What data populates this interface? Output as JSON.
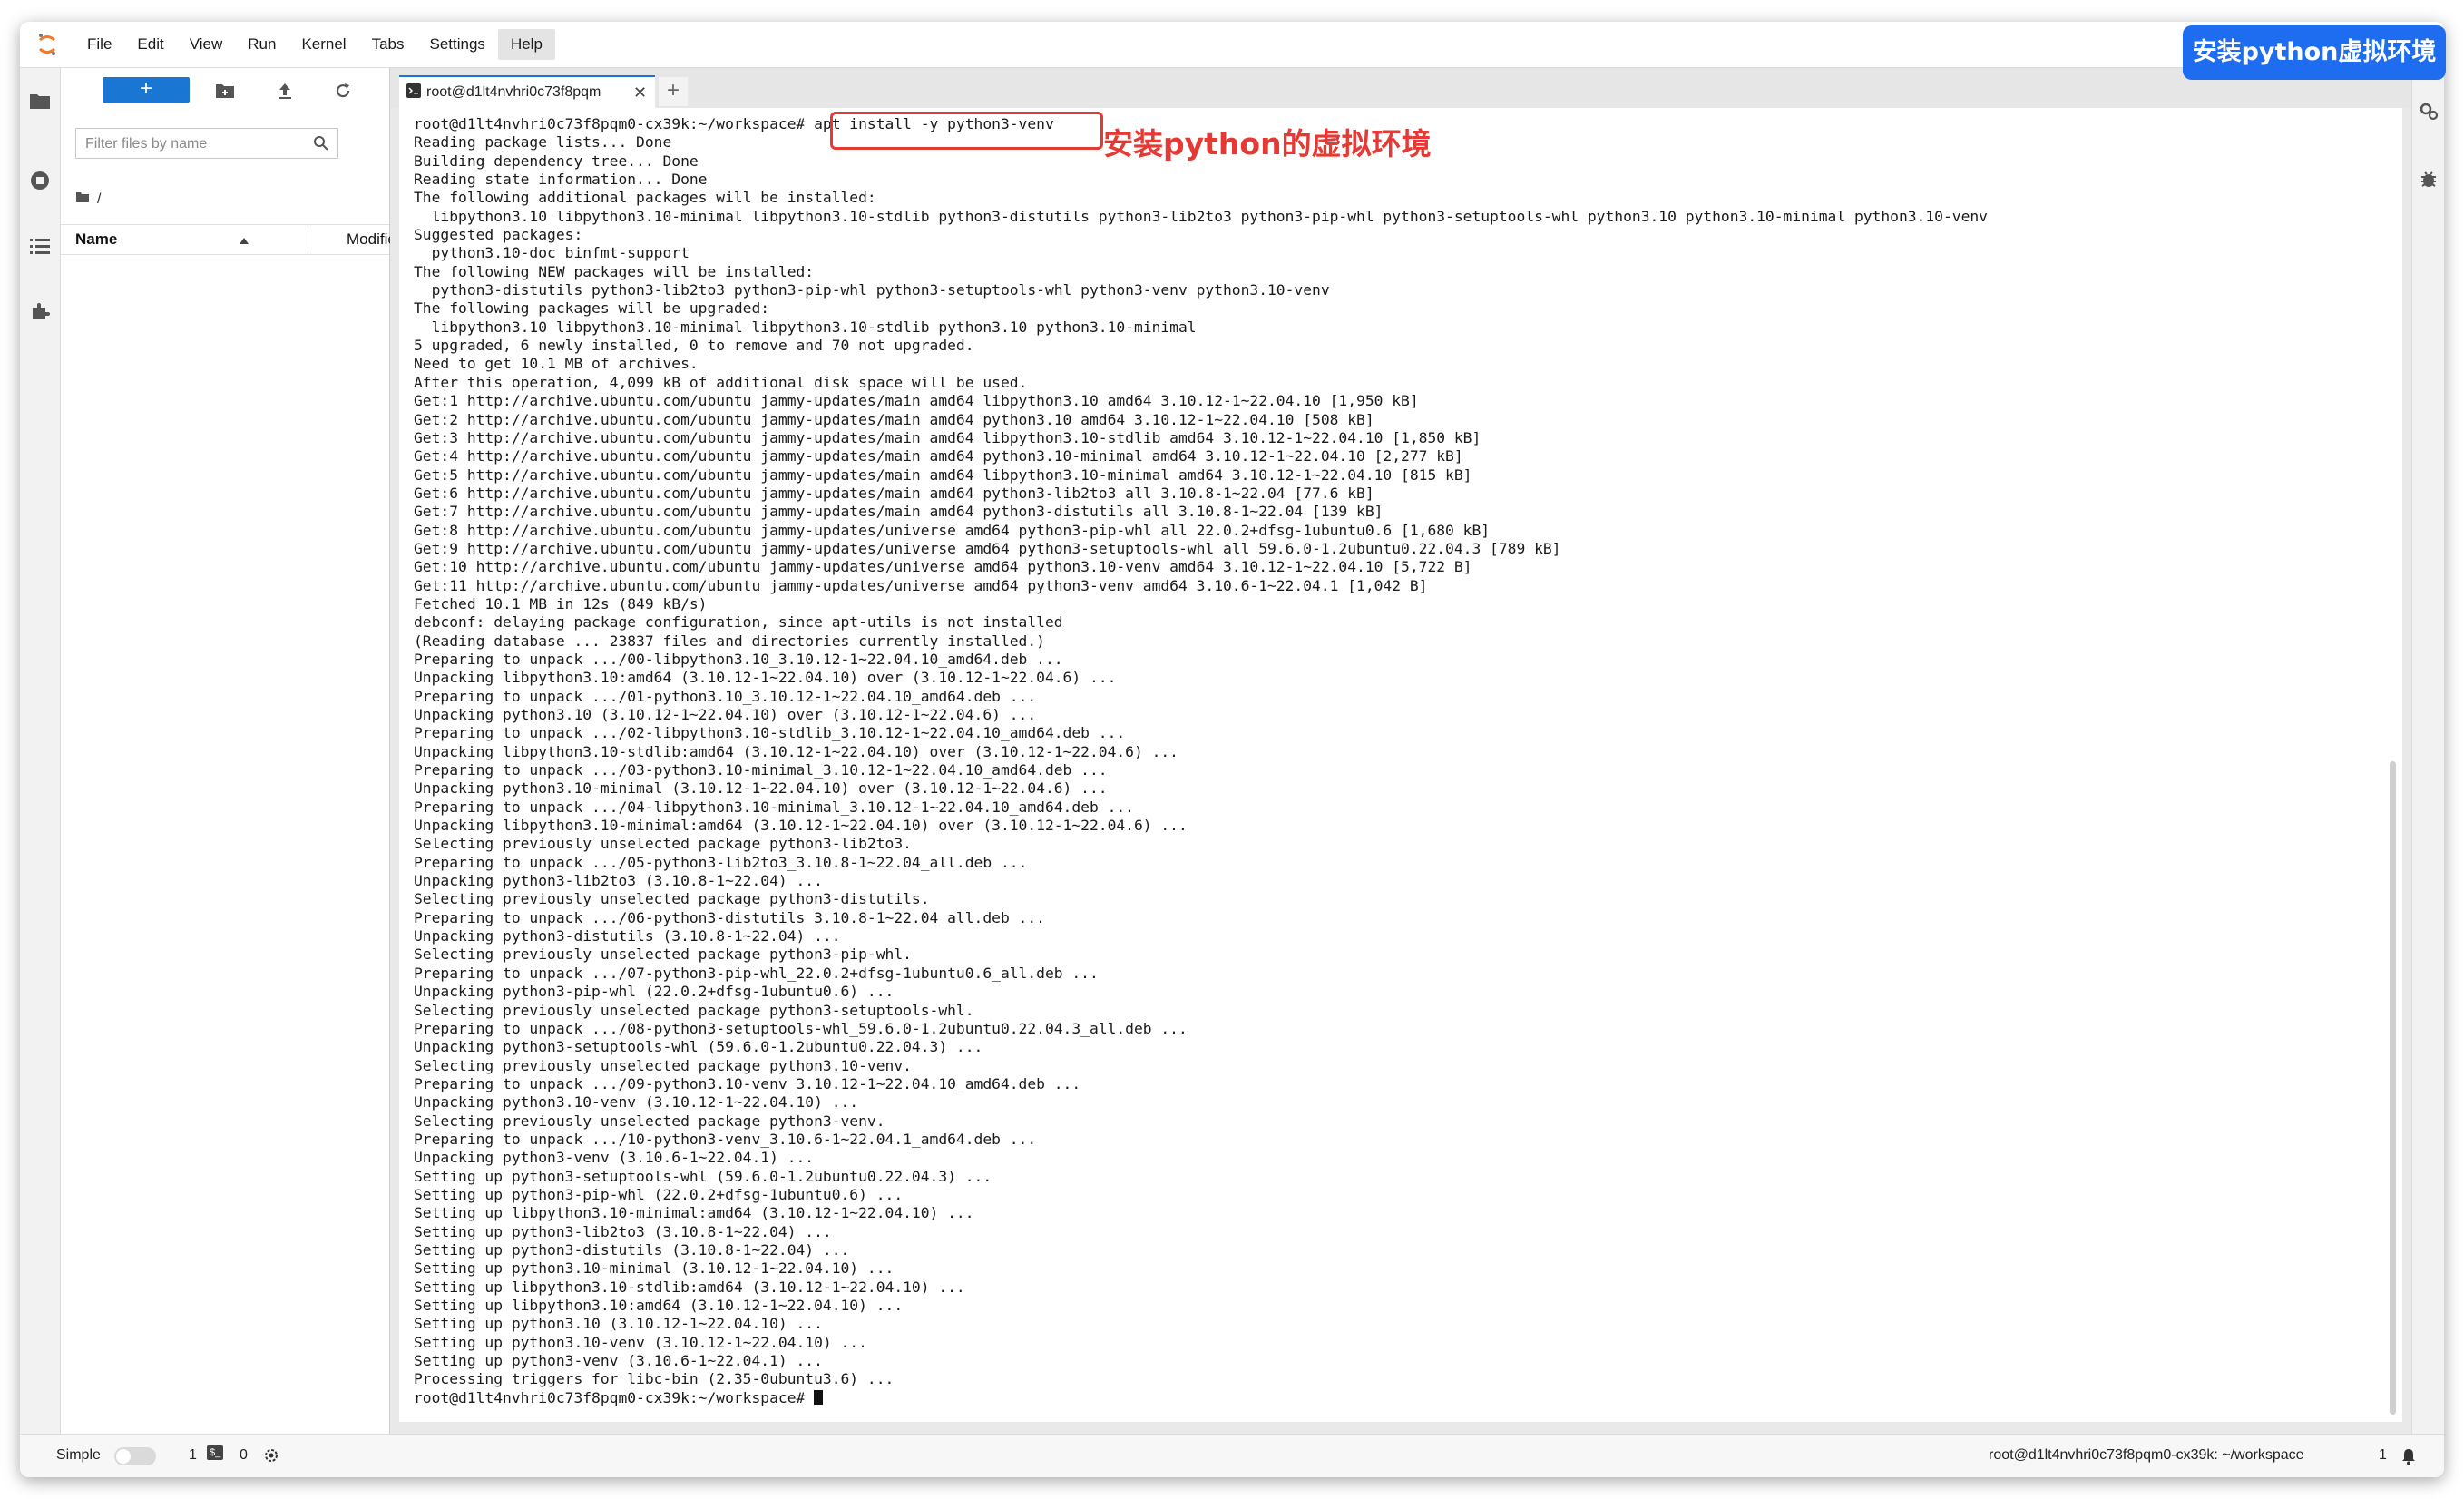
{
  "menu": [
    "File",
    "Edit",
    "View",
    "Run",
    "Kernel",
    "Tabs",
    "Settings",
    "Help"
  ],
  "menu_active": "Help",
  "file_browser": {
    "filter_placeholder": "Filter files by name",
    "breadcrumb": "/",
    "col_name": "Name",
    "col_modified": "Modified"
  },
  "tab": {
    "label": "root@d1lt4nvhri0c73f8pqm",
    "close": "✕",
    "add": "+"
  },
  "terminal_lines": [
    "root@d1lt4nvhri0c73f8pqm0-cx39k:~/workspace# apt install -y python3-venv",
    "Reading package lists... Done",
    "Building dependency tree... Done",
    "Reading state information... Done",
    "The following additional packages will be installed:",
    "  libpython3.10 libpython3.10-minimal libpython3.10-stdlib python3-distutils python3-lib2to3 python3-pip-whl python3-setuptools-whl python3.10 python3.10-minimal python3.10-venv",
    "Suggested packages:",
    "  python3.10-doc binfmt-support",
    "The following NEW packages will be installed:",
    "  python3-distutils python3-lib2to3 python3-pip-whl python3-setuptools-whl python3-venv python3.10-venv",
    "The following packages will be upgraded:",
    "  libpython3.10 libpython3.10-minimal libpython3.10-stdlib python3.10 python3.10-minimal",
    "5 upgraded, 6 newly installed, 0 to remove and 70 not upgraded.",
    "Need to get 10.1 MB of archives.",
    "After this operation, 4,099 kB of additional disk space will be used.",
    "Get:1 http://archive.ubuntu.com/ubuntu jammy-updates/main amd64 libpython3.10 amd64 3.10.12-1~22.04.10 [1,950 kB]",
    "Get:2 http://archive.ubuntu.com/ubuntu jammy-updates/main amd64 python3.10 amd64 3.10.12-1~22.04.10 [508 kB]",
    "Get:3 http://archive.ubuntu.com/ubuntu jammy-updates/main amd64 libpython3.10-stdlib amd64 3.10.12-1~22.04.10 [1,850 kB]",
    "Get:4 http://archive.ubuntu.com/ubuntu jammy-updates/main amd64 python3.10-minimal amd64 3.10.12-1~22.04.10 [2,277 kB]",
    "Get:5 http://archive.ubuntu.com/ubuntu jammy-updates/main amd64 libpython3.10-minimal amd64 3.10.12-1~22.04.10 [815 kB]",
    "Get:6 http://archive.ubuntu.com/ubuntu jammy-updates/main amd64 python3-lib2to3 all 3.10.8-1~22.04 [77.6 kB]",
    "Get:7 http://archive.ubuntu.com/ubuntu jammy-updates/main amd64 python3-distutils all 3.10.8-1~22.04 [139 kB]",
    "Get:8 http://archive.ubuntu.com/ubuntu jammy-updates/universe amd64 python3-pip-whl all 22.0.2+dfsg-1ubuntu0.6 [1,680 kB]",
    "Get:9 http://archive.ubuntu.com/ubuntu jammy-updates/universe amd64 python3-setuptools-whl all 59.6.0-1.2ubuntu0.22.04.3 [789 kB]",
    "Get:10 http://archive.ubuntu.com/ubuntu jammy-updates/universe amd64 python3.10-venv amd64 3.10.12-1~22.04.10 [5,722 B]",
    "Get:11 http://archive.ubuntu.com/ubuntu jammy-updates/universe amd64 python3-venv amd64 3.10.6-1~22.04.1 [1,042 B]",
    "Fetched 10.1 MB in 12s (849 kB/s)",
    "debconf: delaying package configuration, since apt-utils is not installed",
    "(Reading database ... 23837 files and directories currently installed.)",
    "Preparing to unpack .../00-libpython3.10_3.10.12-1~22.04.10_amd64.deb ...",
    "Unpacking libpython3.10:amd64 (3.10.12-1~22.04.10) over (3.10.12-1~22.04.6) ...",
    "Preparing to unpack .../01-python3.10_3.10.12-1~22.04.10_amd64.deb ...",
    "Unpacking python3.10 (3.10.12-1~22.04.10) over (3.10.12-1~22.04.6) ...",
    "Preparing to unpack .../02-libpython3.10-stdlib_3.10.12-1~22.04.10_amd64.deb ...",
    "Unpacking libpython3.10-stdlib:amd64 (3.10.12-1~22.04.10) over (3.10.12-1~22.04.6) ...",
    "Preparing to unpack .../03-python3.10-minimal_3.10.12-1~22.04.10_amd64.deb ...",
    "Unpacking python3.10-minimal (3.10.12-1~22.04.10) over (3.10.12-1~22.04.6) ...",
    "Preparing to unpack .../04-libpython3.10-minimal_3.10.12-1~22.04.10_amd64.deb ...",
    "Unpacking libpython3.10-minimal:amd64 (3.10.12-1~22.04.10) over (3.10.12-1~22.04.6) ...",
    "Selecting previously unselected package python3-lib2to3.",
    "Preparing to unpack .../05-python3-lib2to3_3.10.8-1~22.04_all.deb ...",
    "Unpacking python3-lib2to3 (3.10.8-1~22.04) ...",
    "Selecting previously unselected package python3-distutils.",
    "Preparing to unpack .../06-python3-distutils_3.10.8-1~22.04_all.deb ...",
    "Unpacking python3-distutils (3.10.8-1~22.04) ...",
    "Selecting previously unselected package python3-pip-whl.",
    "Preparing to unpack .../07-python3-pip-whl_22.0.2+dfsg-1ubuntu0.6_all.deb ...",
    "Unpacking python3-pip-whl (22.0.2+dfsg-1ubuntu0.6) ...",
    "Selecting previously unselected package python3-setuptools-whl.",
    "Preparing to unpack .../08-python3-setuptools-whl_59.6.0-1.2ubuntu0.22.04.3_all.deb ...",
    "Unpacking python3-setuptools-whl (59.6.0-1.2ubuntu0.22.04.3) ...",
    "Selecting previously unselected package python3.10-venv.",
    "Preparing to unpack .../09-python3.10-venv_3.10.12-1~22.04.10_amd64.deb ...",
    "Unpacking python3.10-venv (3.10.12-1~22.04.10) ...",
    "Selecting previously unselected package python3-venv.",
    "Preparing to unpack .../10-python3-venv_3.10.6-1~22.04.1_amd64.deb ...",
    "Unpacking python3-venv (3.10.6-1~22.04.1) ...",
    "Setting up python3-setuptools-whl (59.6.0-1.2ubuntu0.22.04.3) ...",
    "Setting up python3-pip-whl (22.0.2+dfsg-1ubuntu0.6) ...",
    "Setting up libpython3.10-minimal:amd64 (3.10.12-1~22.04.10) ...",
    "Setting up python3-lib2to3 (3.10.8-1~22.04) ...",
    "Setting up python3-distutils (3.10.8-1~22.04) ...",
    "Setting up python3.10-minimal (3.10.12-1~22.04.10) ...",
    "Setting up libpython3.10-stdlib:amd64 (3.10.12-1~22.04.10) ...",
    "Setting up libpython3.10:amd64 (3.10.12-1~22.04.10) ...",
    "Setting up python3.10 (3.10.12-1~22.04.10) ...",
    "Setting up python3.10-venv (3.10.12-1~22.04.10) ...",
    "Setting up python3-venv (3.10.6-1~22.04.1) ...",
    "Processing triggers for libc-bin (2.35-0ubuntu3.6) ..."
  ],
  "terminal_prompt": "root@d1lt4nvhri0c73f8pqm0-cx39k:~/workspace# ",
  "annotation_label": "安装python的虚拟环境",
  "corner_banner": "安装python虚拟环境",
  "status": {
    "mode_label": "Simple",
    "count_1": "1",
    "terminal_badge": "$_",
    "count_2": "0",
    "right_label": "root@d1lt4nvhri0c73f8pqm0-cx39k: ~/workspace",
    "right_count": "1"
  },
  "colors": {
    "accent": "#1976d2",
    "annotation_red": "#e53935",
    "banner_blue": "#1e6cf0"
  }
}
